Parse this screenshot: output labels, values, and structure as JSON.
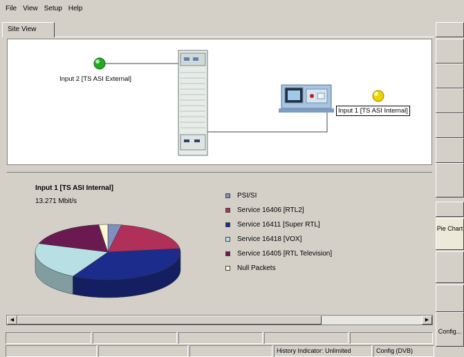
{
  "menu": [
    "File",
    "View",
    "Setup",
    "Help"
  ],
  "tab": {
    "label": "Site View"
  },
  "site_view": {
    "input2_label": "Input 2 [TS ASI External]",
    "input1_label": "Input 1 [TS ASI Internal]",
    "input2_status_color": "#22aa22",
    "input1_status_color": "#e8d400"
  },
  "chart_panel": {
    "title": "Input 1 [TS ASI Internal]",
    "rate": "13.271 Mbit/s"
  },
  "chart_data": {
    "type": "pie",
    "title": "Input 1 [TS ASI Internal]",
    "subtitle": "13.271 Mbit/s",
    "legend_position": "right",
    "slices": [
      {
        "label": "PSI/SI",
        "value": 3,
        "color": "#7f8fbf"
      },
      {
        "label": "Service  16406 [RTL2]",
        "value": 20,
        "color": "#b0305a"
      },
      {
        "label": "Service  16411 [Super RTL]",
        "value": 35,
        "color": "#1c2c8c"
      },
      {
        "label": "Service  16418 [VOX]",
        "value": 22,
        "color": "#b8e0e4"
      },
      {
        "label": "Service  16405 [RTL Television]",
        "value": 18,
        "color": "#6a1a50"
      },
      {
        "label": "Null Packets",
        "value": 2,
        "color": "#fff8d0"
      }
    ]
  },
  "right_buttons": {
    "pie_chart": "Pie Chart",
    "config": "Config..."
  },
  "status_bar": {
    "history": "History Indicator: Unlimited",
    "config": "Config (DVB)"
  }
}
